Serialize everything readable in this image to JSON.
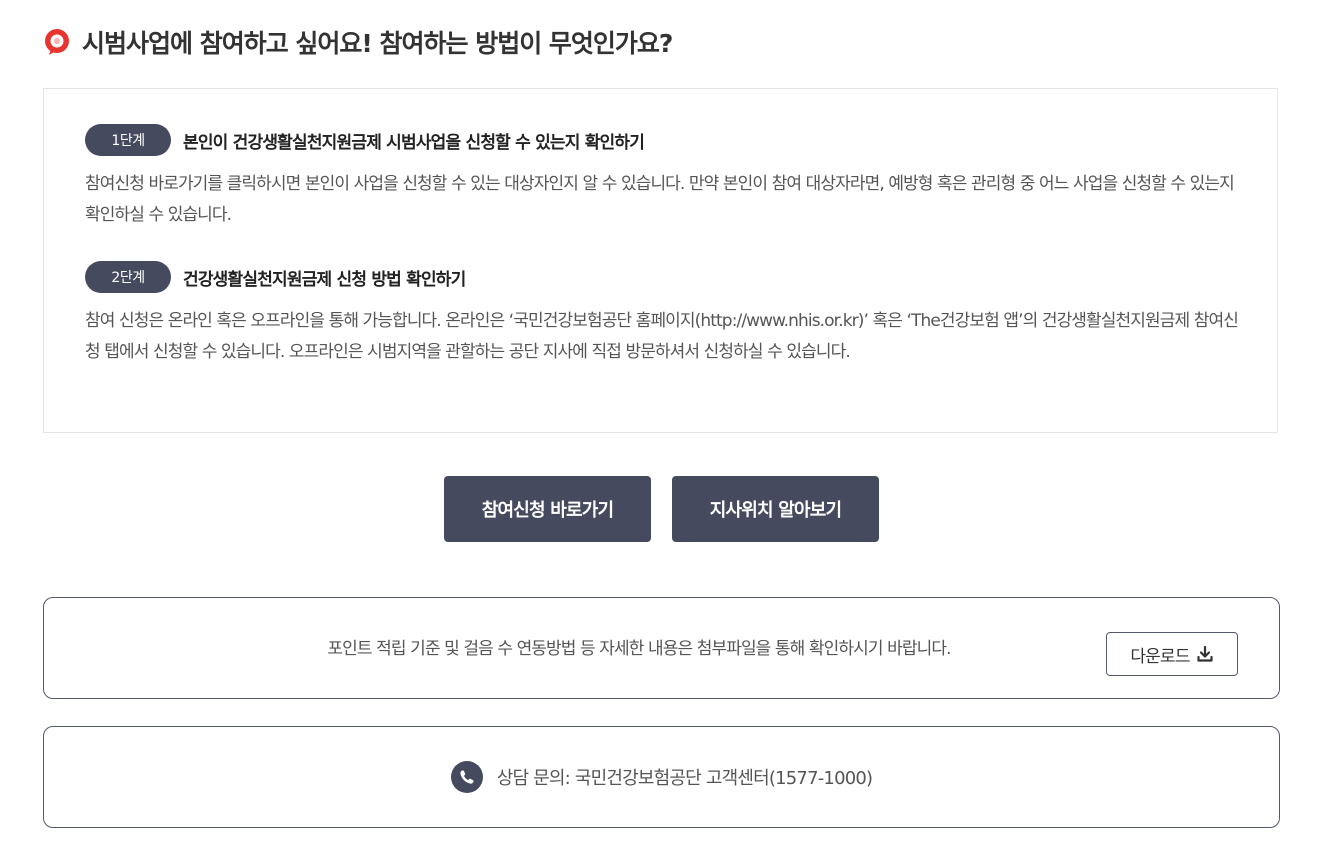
{
  "heading": {
    "icon": "speech-bubble-icon",
    "text": "시범사업에 참여하고 싶어요! 참여하는 방법이 무엇인가요?"
  },
  "steps": [
    {
      "badge": "1단계",
      "title": "본인이 건강생활실천지원금제 시범사업을 신청할 수 있는지 확인하기",
      "description": "참여신청 바로가기를 클릭하시면 본인이 사업을 신청할 수 있는 대상자인지 알 수 있습니다. 만약 본인이 참여 대상자라면, 예방형 혹은 관리형 중 어느 사업을 신청할 수 있는지 확인하실 수 있습니다."
    },
    {
      "badge": "2단계",
      "title": "건강생활실천지원금제 신청 방법 확인하기",
      "description": "참여 신청은 온라인 혹은 오프라인을 통해 가능합니다. 온라인은 ‘국민건강보험공단 홈페이지(http://www.nhis.or.kr)’ 혹은 ‘The건강보험 앱’의 건강생활실천지원금제 참여신청 탭에서 신청할 수 있습니다. 오프라인은 시범지역을 관할하는 공단 지사에 직접 방문하셔서 신청하실 수 있습니다."
    }
  ],
  "buttons": {
    "apply": "참여신청 바로가기",
    "branch": "지사위치 알아보기"
  },
  "notice": {
    "text": "포인트 적립 기준 및 걸음 수 연동방법 등 자세한 내용은 첨부파일을 통해 확인하시기 바랍니다.",
    "download_label": "다운로드",
    "download_icon": "download-icon"
  },
  "contact": {
    "icon": "phone-icon",
    "text": "상담 문의: 국민건강보험공단 고객센터(1577-1000)"
  },
  "colors": {
    "accent": "#e8342f",
    "primary": "#464a5e",
    "border": "#e4e4e4"
  }
}
